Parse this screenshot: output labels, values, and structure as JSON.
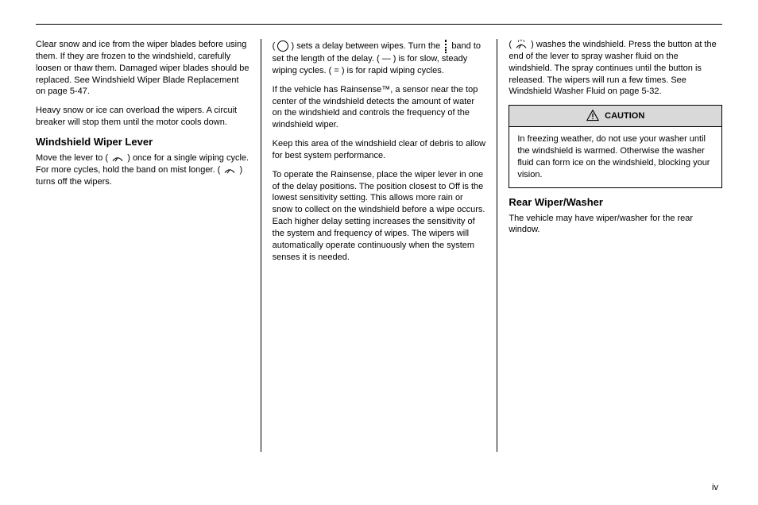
{
  "header": {
    "left": "",
    "right": ""
  },
  "col1": {
    "p1": "Clear snow and ice from the wiper blades before using them. If they are frozen to the windshield, carefully loosen or thaw them. Damaged wiper blades should be replaced. See Windshield Wiper Blade Replacement on page 5-47.",
    "p2": "Heavy snow or ice can overload the wipers. A circuit breaker will stop them until the motor cools down.",
    "title1": "Windshield Wiper Lever",
    "p3_a": "Move the lever to (",
    "p3_b": ") once for a single wiping cycle. For more cycles, hold the band on mist longer. (",
    "p3_c": ") turns off the wipers."
  },
  "col2": {
    "p1_a": "(",
    "p1_b": ") sets a delay between wipes. Turn the",
    "p1_c": "band to set the length of the delay. (",
    "p1_d": ") is for slow, steady wiping cycles. (",
    "p1_e": ") is for rapid wiping cycles.",
    "p2": "If the vehicle has Rainsense™, a sensor near the top center of the windshield detects the amount of water on the windshield and controls the frequency of the windshield wiper.",
    "p3": "Keep this area of the windshield clear of debris to allow for best system performance.",
    "p4": "To operate the Rainsense, place the wiper lever in one of the delay positions. The position closest to Off is the lowest sensitivity setting. This allows more rain or snow to collect on the windshield before a wipe occurs. Each higher delay setting increases the sensitivity of the system and frequency of wipes. The wipers will automatically operate continuously when the system senses it is needed."
  },
  "col3": {
    "p1_a": "(",
    "p1_b": ") washes the windshield. Press the button at the end of the lever to spray washer fluid on the windshield. The spray continues until the button is released. The wipers will run a few times. See Windshield Washer Fluid on page 5-32.",
    "caution_header": "CAUTION",
    "caution_body": "In freezing weather, do not use your washer until the windshield is warmed. Otherwise the washer fluid can form ice on the windshield, blocking your vision.",
    "title1": "Rear Wiper/Washer",
    "p2": "The vehicle may have wiper/washer for the rear window."
  },
  "page_number": "iv"
}
